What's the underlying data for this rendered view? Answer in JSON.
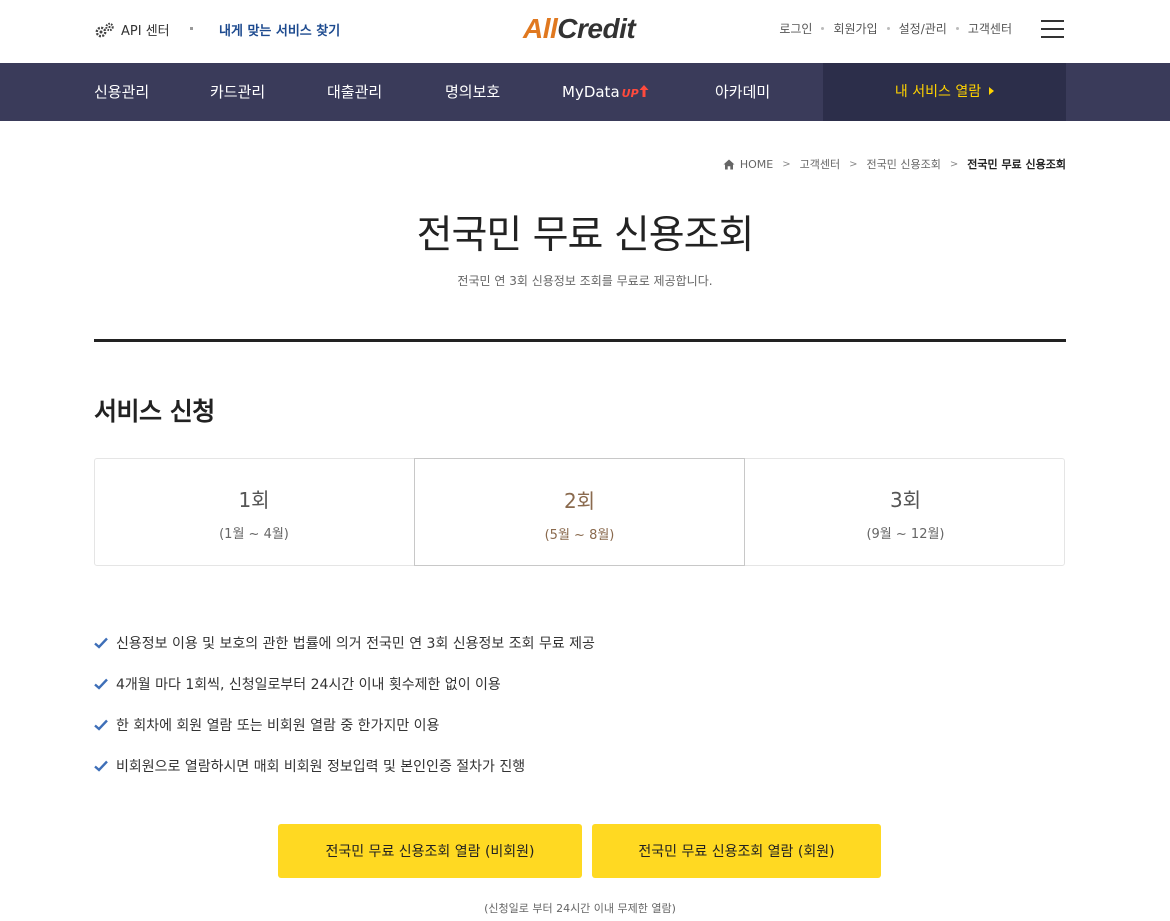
{
  "header": {
    "api_center_label": "API 센터",
    "find_service_label": "내게 맞는 서비스 찾기",
    "logo_all": "All",
    "logo_credit": "Credit",
    "util_links": [
      "로그인",
      "회원가입",
      "설정/관리",
      "고객센터"
    ],
    "menu_icon": "hamburger-menu-icon"
  },
  "gnb": {
    "items": [
      "신용관리",
      "카드관리",
      "대출관리",
      "명의보호",
      "MyData",
      "아카데미"
    ],
    "mydata_badge": "UP",
    "my_service_label": "내 서비스 열람"
  },
  "breadcrumb": {
    "home": "HOME",
    "items": [
      "고객센터",
      "전국민 신용조회"
    ],
    "current": "전국민 무료 신용조회"
  },
  "page": {
    "title": "전국민 무료 신용조회",
    "subtitle": "전국민 연 3회 신용정보 조회를 무료로 제공합니다."
  },
  "section": {
    "title": "서비스 신청",
    "rounds": [
      {
        "label": "1회",
        "range": "(1월 ~ 4월)"
      },
      {
        "label": "2회",
        "range": "(5월 ~ 8월)",
        "selected": true
      },
      {
        "label": "3회",
        "range": "(9월 ~ 12월)"
      }
    ],
    "notes": [
      "신용정보 이용 및 보호의 관한 법률에 의거 전국민 연 3회 신용정보 조회 무료 제공",
      "4개월 마다 1회씩, 신청일로부터 24시간 이내 횟수제한 없이 이용",
      "한 회차에 회원 열람 또는 비회원 열람 중 한가지만 이용",
      "비회원으로 열람하시면 매회 비회원 정보입력 및 본인인증 절차가 진행"
    ]
  },
  "buttons": {
    "nonmember": "전국민 무료 신용조회 열람 (비회원)",
    "member": "전국민 무료 신용조회 열람 (회원)",
    "note": "(신청일로 부터 24시간 이내 무제한 열람)"
  },
  "colors": {
    "gnb_bg": "#3a3b5a",
    "accent_yellow": "#ffd922",
    "logo_orange": "#e0781f",
    "check_blue": "#3e6fb8"
  }
}
